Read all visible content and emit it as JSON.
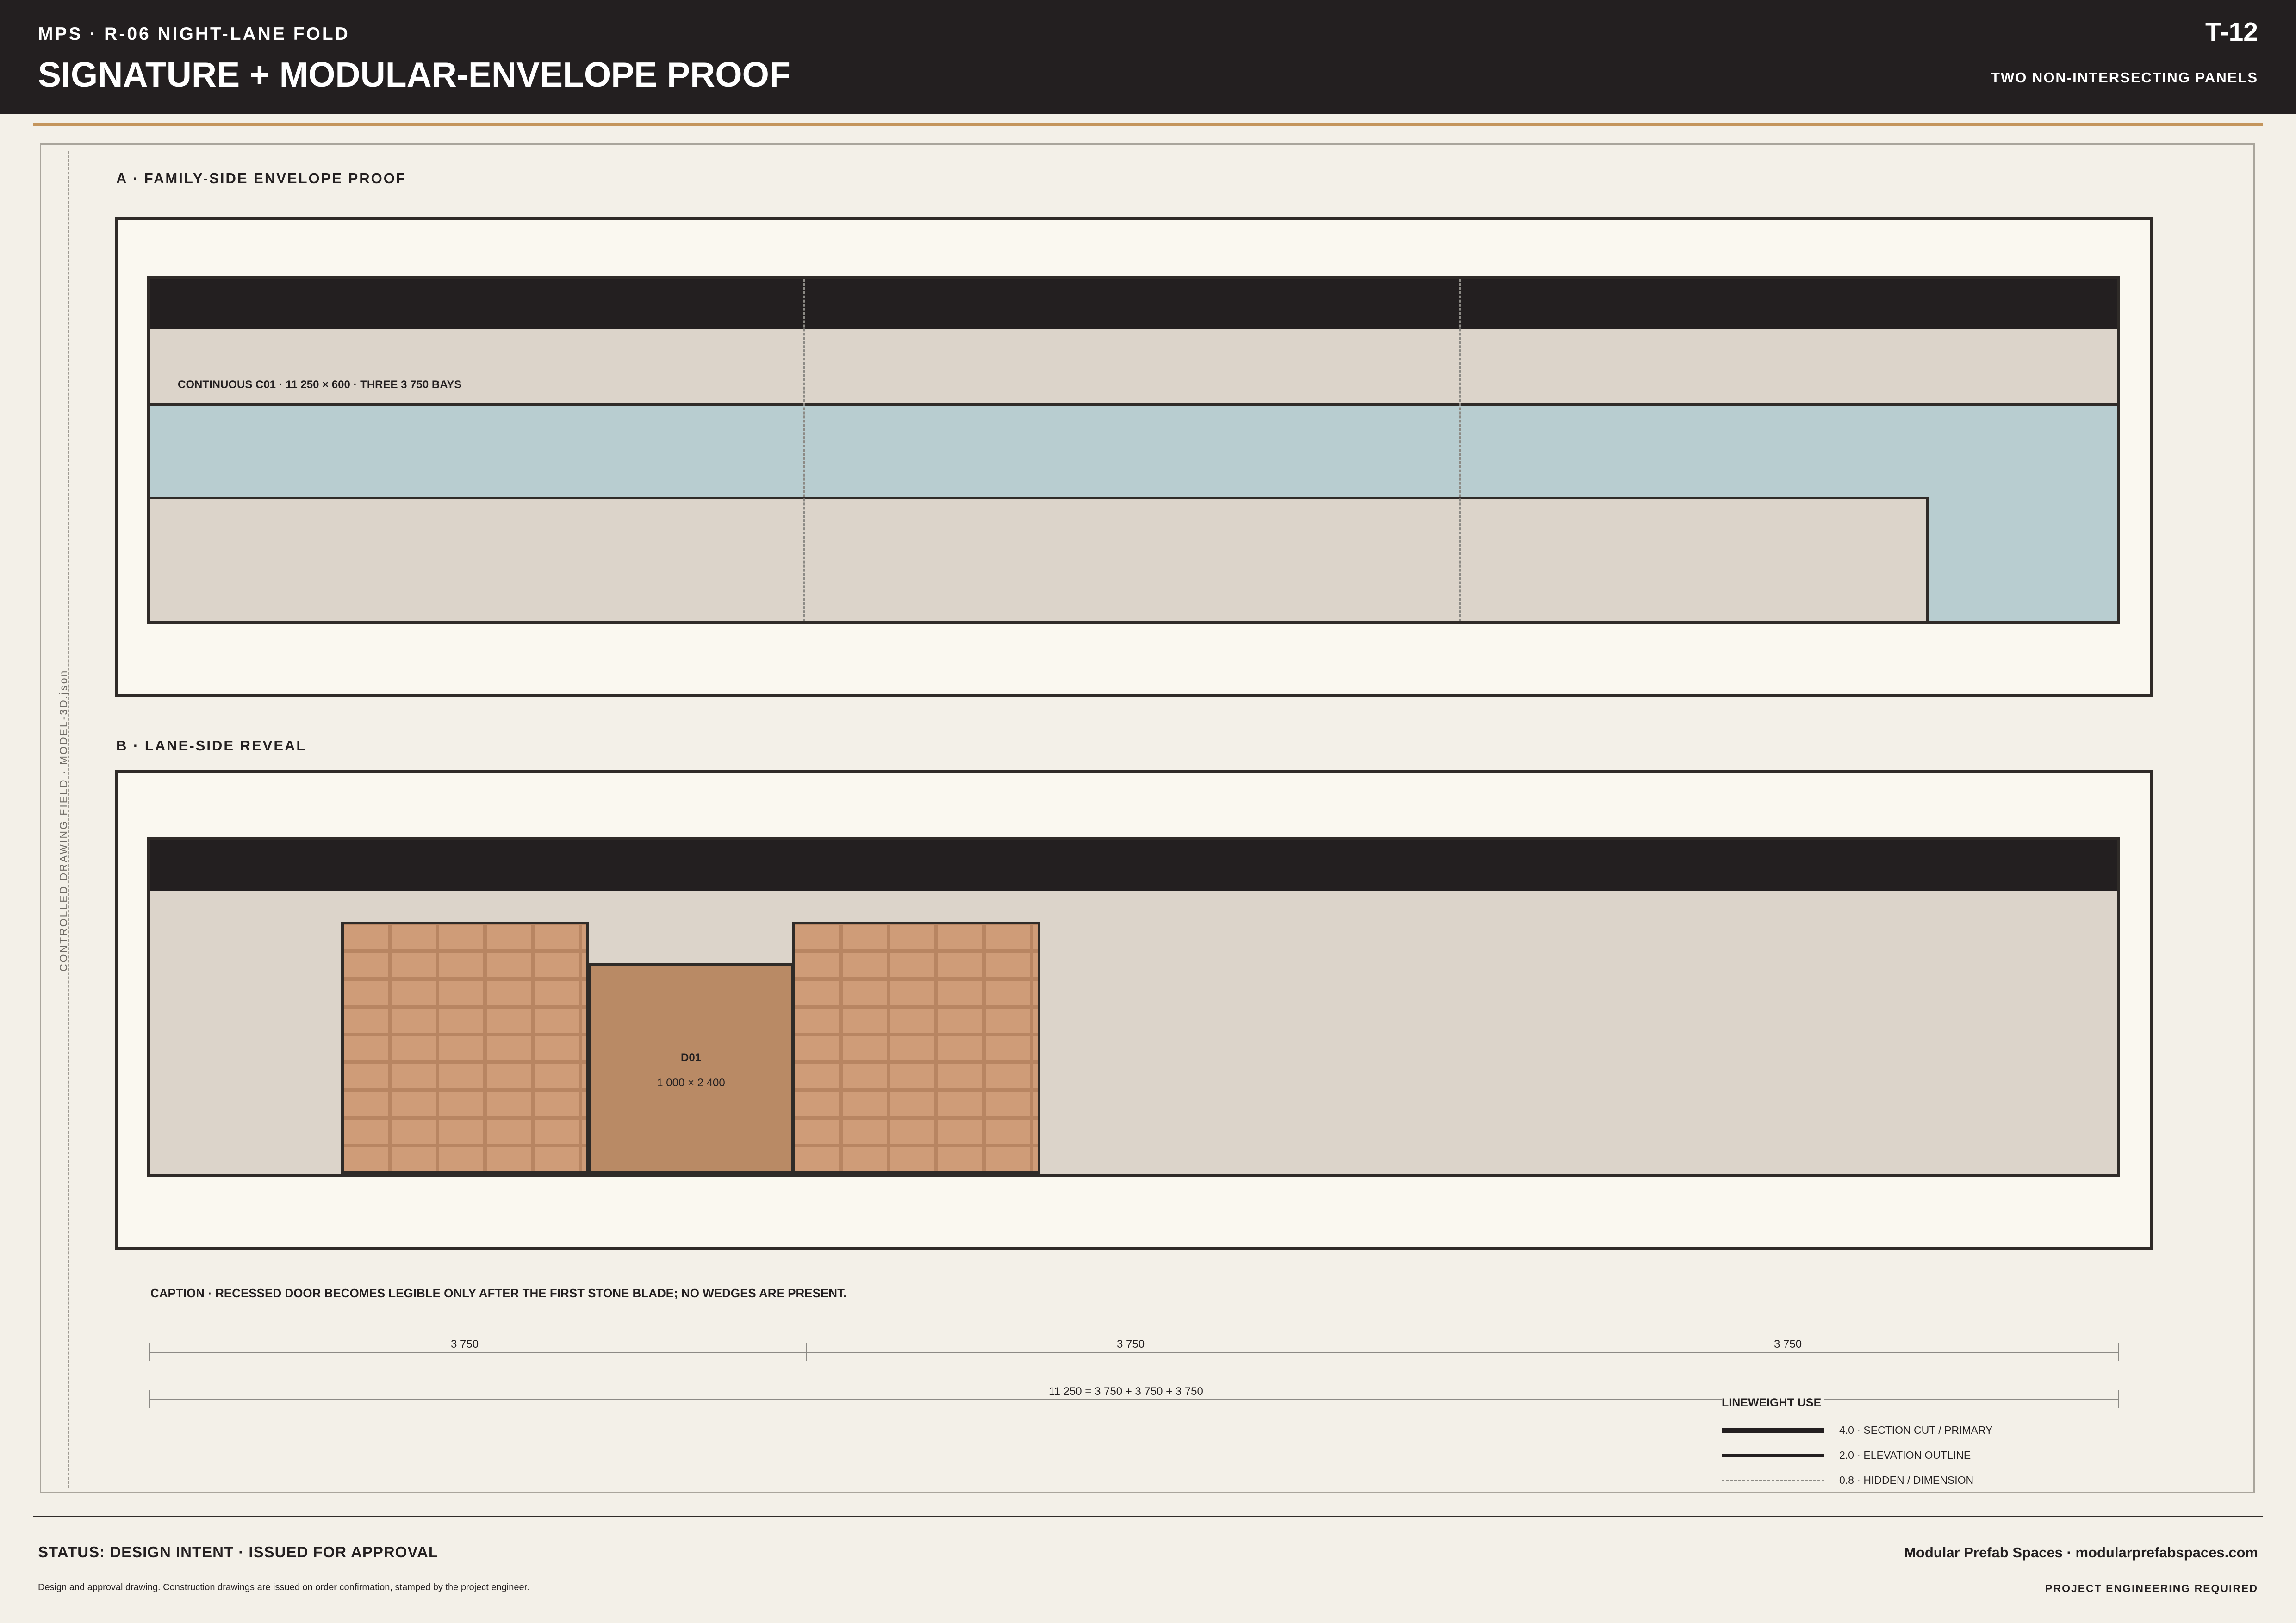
{
  "header": {
    "project": "MPS · R-06 NIGHT-LANE FOLD",
    "title": "SIGNATURE + MODULAR-ENVELOPE PROOF",
    "sheet_number": "T-12",
    "subtitle": "TWO NON-INTERSECTING PANELS"
  },
  "side_label": "CONTROLLED DRAWING FIELD · MODEL-3D.json",
  "panel_a": {
    "title": "A · FAMILY-SIDE ENVELOPE PROOF",
    "band_label": "CONTINUOUS C01 · 11 250 × 600 · THREE 3 750 BAYS"
  },
  "panel_b": {
    "title": "B · LANE-SIDE REVEAL",
    "door_id": "D01",
    "door_size": "1 000 × 2 400"
  },
  "caption": "CAPTION · RECESSED DOOR BECOMES LEGIBLE ONLY AFTER THE FIRST STONE BLADE; NO WEDGES ARE PRESENT.",
  "dimensions": {
    "bays": [
      "3 750",
      "3 750",
      "3 750"
    ],
    "total": "11 250 = 3 750 + 3 750 + 3 750"
  },
  "legend": {
    "title": "LINEWEIGHT USE",
    "items": [
      {
        "label": "4.0 · SECTION CUT / PRIMARY",
        "style": "solid-heavy"
      },
      {
        "label": "2.0 · ELEVATION OUTLINE",
        "style": "solid"
      },
      {
        "label": "0.8 · HIDDEN / DIMENSION",
        "style": "dashed"
      }
    ]
  },
  "footer": {
    "status": "STATUS: DESIGN INTENT · ISSUED FOR APPROVAL",
    "disclaimer": "Design and approval drawing. Construction drawings are issued on order confirmation, stamped by the project engineer.",
    "company": "Modular Prefab Spaces · modularprefabspaces.com",
    "engineering": "PROJECT ENGINEERING REQUIRED"
  },
  "colors": {
    "ink": "#231f20",
    "paper": "#f3f0e8",
    "panel": "#faf8f0",
    "cladding": "#dcd4ca",
    "glazing": "#b8cdd0",
    "module": "#cf9c78",
    "door": "#b98a65",
    "accent": "#c4955c"
  }
}
